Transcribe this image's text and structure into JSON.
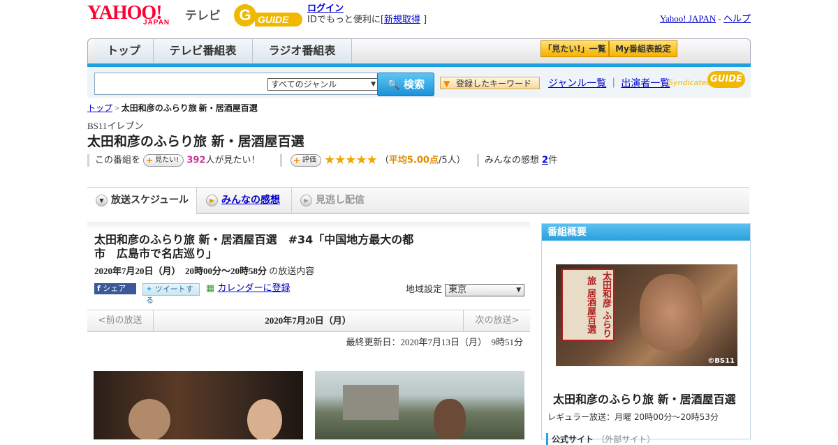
{
  "header": {
    "yahoo_logo": "YAHOO!",
    "japan_logo": "JAPAN",
    "tv_label": "テレビ",
    "gguide_mark": "G",
    "gguide_text": "GUIDE",
    "login": "ログイン",
    "login_sub_prefix": "IDでもっと便利に[",
    "register": "新規取得",
    "login_sub_suffix": "]",
    "yahoo_japan_link": "Yahoo! JAPAN",
    "separator": "-",
    "help_link": "ヘルプ"
  },
  "nav": {
    "tabs": [
      "トップ",
      "テレビ番組表",
      "ラジオ番組表"
    ],
    "mitai_list": "「見たい!」一覧",
    "my_schedule": "My番組表設定"
  },
  "search": {
    "genre_selected": "すべてのジャンル",
    "search_button": "検索",
    "keyword_button": "登録したキーワード",
    "genre_list_link": "ジャンル一覧",
    "cast_list_link": "出演者一覧",
    "syndicated": "Syndicated",
    "syndicated_logo": "GUIDE"
  },
  "breadcrumb": {
    "top": "トップ",
    "sep": ">",
    "current": "太田和彦のふらり旅 新・居酒屋百選"
  },
  "program": {
    "station": "BS11イレブン",
    "title": "太田和彦のふらり旅 新・居酒屋百選",
    "mitai_prefix": "この番組を",
    "mitai_button": "見たい!",
    "mitai_count": "392",
    "mitai_suffix": "人が見たい！",
    "rating_button": "評価",
    "stars": "★★★★★",
    "rating_open": "（",
    "rating_avg": "平均5.00点",
    "rating_count": "/5人）",
    "impressions_prefix": "みんなの感想",
    "impressions_count": "2",
    "impressions_suffix": "件"
  },
  "content_tabs": [
    "放送スケジュール",
    "みんなの感想",
    "見逃し配信"
  ],
  "episode": {
    "title": "太田和彦のふらり旅 新・居酒屋百選　#34「中国地方最大の都市　広島市で名店巡り」",
    "date": "2020年7月20日（月）　20時00分～20時58分",
    "date_suffix": "の放送内容",
    "facebook_share": "シェア",
    "tweet": "ツイートする",
    "calendar": "カレンダーに登録",
    "region_label": "地域設定",
    "region_selected": "東京"
  },
  "pager": {
    "prev": "<前の放送",
    "current": "2020年7月20日（月）",
    "next": "次の放送>"
  },
  "updated": "最終更新日：2020年7月13日（月）　9時51分",
  "sidebar": {
    "heading": "番組概要",
    "poster_text": "太田和彦 ふらり旅 居酒屋百選",
    "copyright": "©BS11",
    "title": "太田和彦のふらり旅 新・居酒屋百選",
    "regular": "レギュラー放送：月曜 20時00分～20時53分",
    "official_label": "公式サイト",
    "official_note": "（外部サイト）"
  },
  "colors": {
    "accent_blue": "#1ca0e0",
    "link": "#0000cc",
    "star": "#f0a500",
    "count_magenta": "#cc3399",
    "yahoo_red": "#ff0033"
  }
}
